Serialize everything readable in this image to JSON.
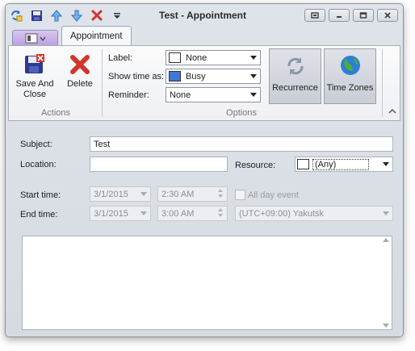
{
  "window": {
    "title": "Test - Appointment"
  },
  "tabs": {
    "file_icon": "calendar-menu-icon",
    "appointment": "Appointment"
  },
  "ribbon": {
    "actions": {
      "save_and_close": "Save And Close",
      "delete": "Delete",
      "group_label": "Actions"
    },
    "options": {
      "label_caption": "Label:",
      "label_value": "None",
      "label_color": "#ffffff",
      "show_time_as_caption": "Show time as:",
      "show_time_as_value": "Busy",
      "show_time_as_color": "#3c78d8",
      "reminder_caption": "Reminder:",
      "reminder_value": "None",
      "group_label": "Options"
    },
    "recurrence": "Recurrence",
    "time_zones": "Time Zones"
  },
  "form": {
    "subject_label": "Subject:",
    "subject_value": "Test",
    "location_label": "Location:",
    "location_value": "",
    "resource_label": "Resource:",
    "resource_value": "(Any)",
    "start_time_label": "Start time:",
    "start_date": "3/1/2015",
    "start_time": "2:30 AM",
    "all_day_label": "All day event",
    "end_time_label": "End time:",
    "end_date": "3/1/2015",
    "end_time": "3:00 AM",
    "timezone_value": "(UTC+09:00) Yakutsk",
    "notes_value": ""
  }
}
